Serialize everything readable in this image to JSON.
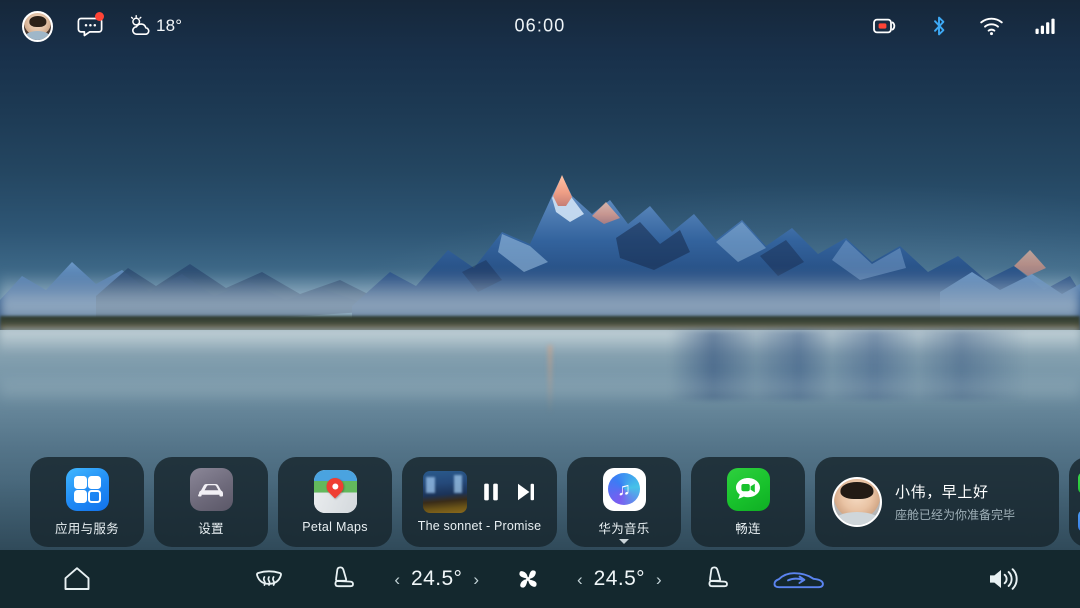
{
  "status_bar": {
    "avatar": {
      "name": "user-avatar",
      "alt": "driver profile photo"
    },
    "messages": {
      "icon": "message-bubble-icon",
      "has_unread": true,
      "badge_color": "#ff4436"
    },
    "weather": {
      "icon": "sun-behind-cloud-icon",
      "temperature": "18°"
    },
    "clock": "06:00",
    "right_icons": [
      {
        "name": "dashcam-record-icon",
        "label": "dashcam",
        "color": "#ff4436"
      },
      {
        "name": "bluetooth-icon",
        "label": "Bluetooth",
        "color": "#3da9f5"
      },
      {
        "name": "wifi-icon",
        "label": "Wi-Fi",
        "color": "#ffffff"
      },
      {
        "name": "cellular-signal-icon",
        "label": "signal",
        "color": "#ffffff",
        "bars": 4
      }
    ]
  },
  "wallpaper": {
    "scene": "snow-capped mountain at dawn over a misty lake",
    "sky_top": "#16273a",
    "sky_bottom": "#5d89a4",
    "lake_top": "#93aab4",
    "lake_bottom": "#4e7088",
    "peak_glow": "#f0a389"
  },
  "dock": {
    "items": [
      {
        "type": "app",
        "name": "apps-and-services",
        "label": "应用与服务",
        "icon": "app-grid-icon",
        "accent": "#1f8af5"
      },
      {
        "type": "app",
        "name": "settings",
        "label": "设置",
        "icon": "car-icon",
        "accent": "#6e6a7b"
      },
      {
        "type": "app",
        "name": "petal-maps",
        "label": "Petal Maps",
        "icon": "map-pin-icon",
        "accent": "#ef3e33"
      },
      {
        "type": "media",
        "name": "now-playing",
        "title": "The sonnet - Promise",
        "album_art": "concert stage album artwork",
        "controls": [
          {
            "name": "pause-button",
            "glyph": "pause"
          },
          {
            "name": "next-track-button",
            "glyph": "next"
          }
        ]
      },
      {
        "type": "app",
        "name": "huawei-music",
        "label": "华为音乐",
        "icon": "music-note-icon",
        "expandable": true
      },
      {
        "type": "app",
        "name": "meetime",
        "label": "畅连",
        "icon": "video-chat-icon",
        "accent": "#18c22c"
      },
      {
        "type": "greeting",
        "name": "greeting-card",
        "title": "小伟，早上好",
        "subtitle": "座舱已经为你准备完毕"
      },
      {
        "type": "peek",
        "name": "partial-card",
        "label": ""
      }
    ]
  },
  "bottom_bar": {
    "home": {
      "name": "home-button",
      "icon": "home-icon"
    },
    "controls": [
      {
        "name": "steering-wheel-heater-button",
        "icon": "steering-wheel-heat-icon",
        "active": false
      },
      {
        "name": "driver-seat-heater-button",
        "icon": "seat-heat-icon",
        "active": false
      }
    ],
    "temperature_left": {
      "name": "driver-temperature",
      "value": "24.5°",
      "dec": "‹",
      "inc": "›"
    },
    "fan": {
      "name": "fan-button",
      "icon": "fan-icon"
    },
    "temperature_right": {
      "name": "passenger-temperature",
      "value": "24.5°",
      "dec": "‹",
      "inc": "›"
    },
    "controls_right": [
      {
        "name": "passenger-seat-heater-button",
        "icon": "seat-heat-icon",
        "active": false
      },
      {
        "name": "air-recirculation-button",
        "icon": "car-recirculation-icon",
        "active": true,
        "color": "#5b84f0"
      }
    ],
    "volume": {
      "name": "volume-button",
      "icon": "speaker-volume-icon"
    }
  }
}
